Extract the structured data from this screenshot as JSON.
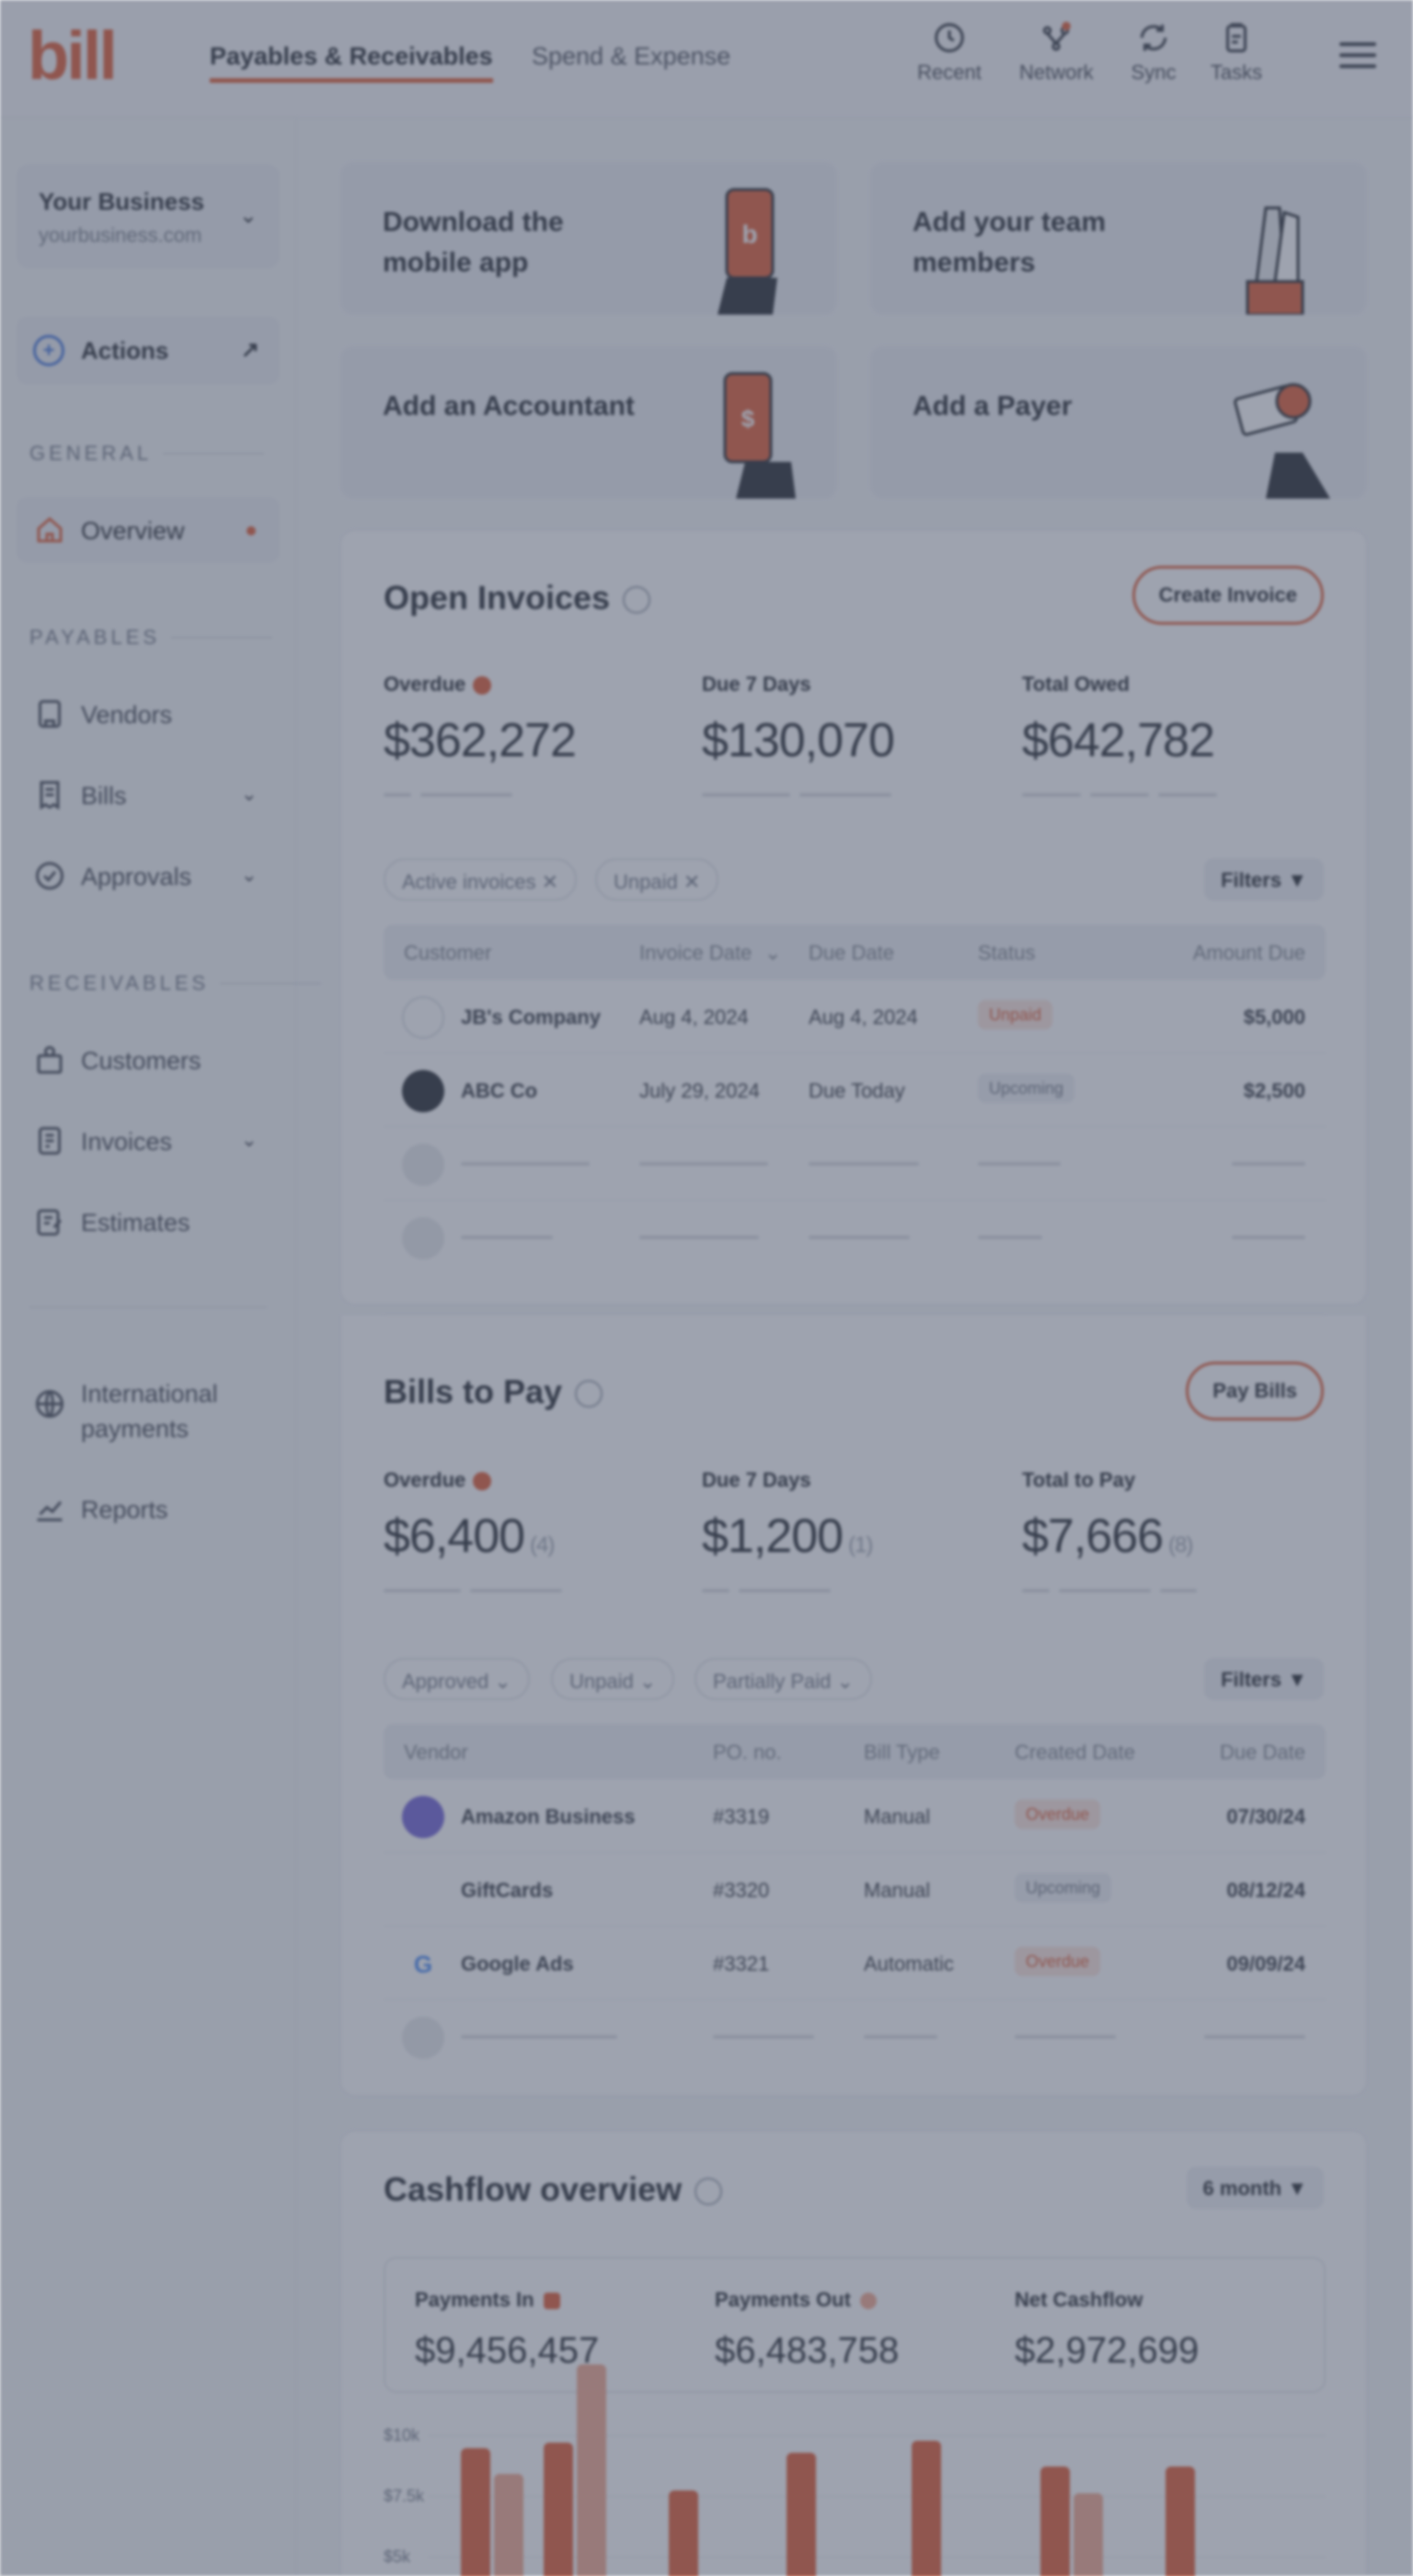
{
  "app": {
    "logo": "bill"
  },
  "topnav": {
    "tabs": [
      {
        "label": "Payables & Receivables"
      },
      {
        "label": "Spend & Expense"
      }
    ],
    "icons": [
      {
        "label": "Recent",
        "icon": "history-icon"
      },
      {
        "label": "Network",
        "icon": "network-icon"
      },
      {
        "label": "Sync",
        "icon": "sync-icon"
      },
      {
        "label": "Tasks",
        "icon": "tasks-icon"
      }
    ]
  },
  "sidebar": {
    "business": {
      "name": "Your Business",
      "domain": "yourbusiness.com"
    },
    "actions_label": "Actions",
    "sections": {
      "general": "GENERAL",
      "payables": "PAYABLES",
      "receivables": "RECEIVABLES"
    },
    "items": [
      {
        "label": "Overview"
      },
      {
        "label": "Vendors"
      },
      {
        "label": "Bills"
      },
      {
        "label": "Approvals"
      },
      {
        "label": "Customers"
      },
      {
        "label": "Invoices"
      },
      {
        "label": "Estimates"
      },
      {
        "label": "International payments"
      },
      {
        "label": "Reports"
      }
    ]
  },
  "promos": [
    {
      "title": "Download the mobile app"
    },
    {
      "title": "Add your team members"
    },
    {
      "title": "Add an Accountant"
    },
    {
      "title": "Add a Payer"
    }
  ],
  "invoices": {
    "title": "Open Invoices",
    "button": "Create Invoice",
    "stats": [
      {
        "label": "Overdue",
        "value": "$362,272"
      },
      {
        "label": "Due 7 Days",
        "value": "$130,070"
      },
      {
        "label": "Total Owed",
        "value": "$642,782"
      }
    ],
    "chips": [
      "Active invoices",
      "Unpaid"
    ],
    "filters": "Filters",
    "columns": [
      "Customer",
      "Invoice Date",
      "Due Date",
      "Status",
      "Amount Due"
    ],
    "rows": [
      {
        "customer": "JB's Company",
        "invoice_date": "Aug 4, 2024",
        "due_date": "Aug 4, 2024",
        "status": "Unpaid",
        "amount": "$5,000"
      },
      {
        "customer": "ABC Co",
        "invoice_date": "July 29, 2024",
        "due_date": "Due Today",
        "status": "Upcoming",
        "amount": "$2,500"
      }
    ]
  },
  "bills": {
    "title": "Bills to Pay",
    "button": "Pay Bills",
    "stats": [
      {
        "label": "Overdue",
        "value": "$6,400",
        "count": "(4)"
      },
      {
        "label": "Due 7 Days",
        "value": "$1,200",
        "count": "(1)"
      },
      {
        "label": "Total to Pay",
        "value": "$7,666",
        "count": "(8)"
      }
    ],
    "chips": [
      "Approved",
      "Unpaid",
      "Partially Paid"
    ],
    "filters": "Filters",
    "columns": [
      "Vendor",
      "PO. no.",
      "Bill Type",
      "Created Date",
      "Due Date"
    ],
    "rows": [
      {
        "vendor": "Amazon Business",
        "po": "#3319",
        "type": "Manual",
        "status": "Overdue",
        "due": "07/30/24"
      },
      {
        "vendor": "GiftCards",
        "po": "#3320",
        "type": "Manual",
        "status": "Upcoming",
        "due": "08/12/24"
      },
      {
        "vendor": "Google Ads",
        "po": "#3321",
        "type": "Automatic",
        "status": "Overdue",
        "due": "09/09/24"
      }
    ]
  },
  "cashflow": {
    "title": "Cashflow overview",
    "period": "6 month",
    "stats": [
      {
        "label": "Payments In",
        "value": "$9,456,457",
        "color": "#e0542c"
      },
      {
        "label": "Payments Out",
        "value": "$6,483,758",
        "color": "#f2a58b"
      },
      {
        "label": "Net Cashflow",
        "value": "$2,972,699"
      }
    ],
    "y_ticks": [
      "$10k",
      "$7.5k",
      "$5k"
    ],
    "chart_data": {
      "type": "bar",
      "series": [
        {
          "name": "Payments In",
          "values": [
            5.4,
            5.6,
            3.6,
            5.2,
            5.7,
            4.6,
            4.6
          ]
        },
        {
          "name": "Payments Out",
          "values": [
            4.3,
            8.9,
            0,
            0,
            0,
            3.5,
            0
          ]
        }
      ],
      "ylim": [
        0,
        10
      ]
    }
  }
}
